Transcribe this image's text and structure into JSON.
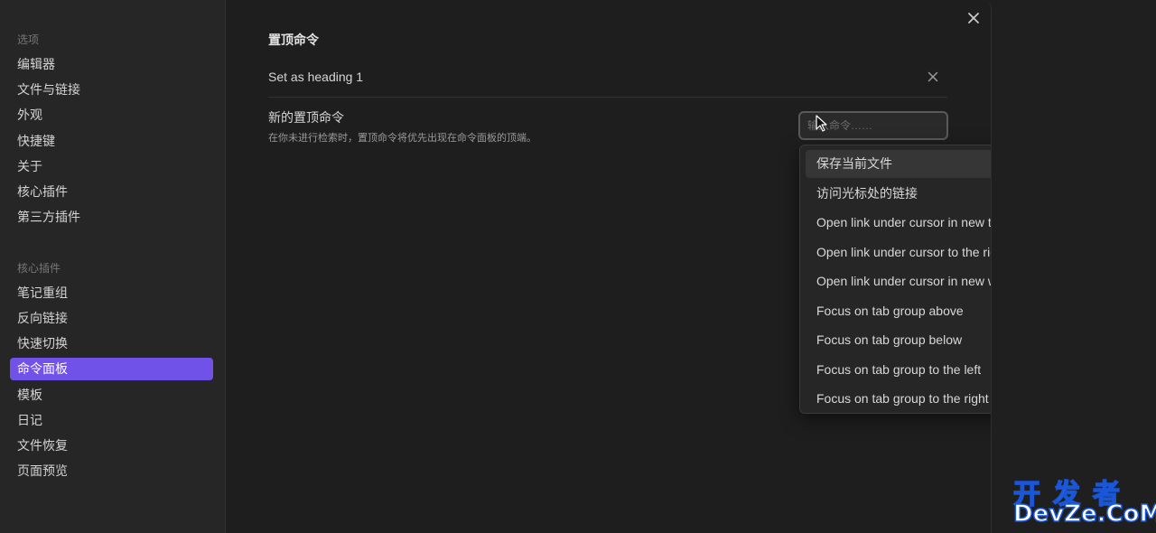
{
  "sidebar": {
    "sections": [
      {
        "title": "选项",
        "items": [
          "编辑器",
          "文件与链接",
          "外观",
          "快捷键",
          "关于",
          "核心插件",
          "第三方插件"
        ]
      },
      {
        "title": "核心插件",
        "items": [
          "笔记重组",
          "反向链接",
          "快速切换",
          "命令面板",
          "模板",
          "日记",
          "文件恢复",
          "页面预览"
        ]
      }
    ],
    "active_item": "命令面板"
  },
  "content": {
    "heading": "置顶命令",
    "pinned_commands": [
      {
        "label": "Set as heading 1"
      }
    ],
    "new_pinned": {
      "label": "新的置顶命令",
      "description": "在你未进行检索时，置顶命令将优先出现在命令面板的顶端。",
      "input_placeholder": "输入命令……",
      "input_value": ""
    },
    "suggestions": [
      "保存当前文件",
      "访问光标处的链接",
      "Open link under cursor in new tab",
      "Open link under cursor to the right",
      "Open link under cursor in new window",
      "Focus on tab group above",
      "Focus on tab group below",
      "Focus on tab group to the left",
      "Focus on tab group to the right"
    ],
    "highlighted_suggestion": 0
  },
  "icons": {
    "close": "close-icon",
    "remove": "close-icon",
    "cursor": "mouse-pointer-icon"
  },
  "colors": {
    "accent": "#7152e8",
    "background": "#1e1e1e",
    "sidebar": "#262626"
  },
  "watermark": {
    "top": "开发者",
    "bottom": "DevZe.CoM"
  }
}
